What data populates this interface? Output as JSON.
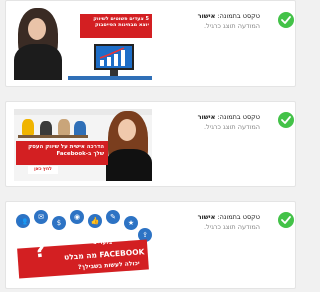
{
  "accent_check_color": "#43c248",
  "ad_red": "#d31f22",
  "ad_blue": "#2d73c4",
  "items": [
    {
      "status_label": "טקסט בתמונה:",
      "status_value": "אישור",
      "status_sub": "המודעה תוצג כרגיל.",
      "thumb": {
        "headline": "5 צעדים פשוטים לשיווק יוצא מבחינות הפייסבוק"
      }
    },
    {
      "status_label": "טקסט בתמונה:",
      "status_value": "אישור",
      "status_sub": "המודעה תוצג כרגיל.",
      "thumb": {
        "headline": "הדרכה אישית על שיווק העסק שלך ב-Facebook",
        "cta": "לחץ כאן"
      }
    },
    {
      "status_label": "טקסט בתמונה:",
      "status_value": "אישור",
      "status_sub": "המודעה תוצג כרגיל.",
      "thumb": {
        "kicker": "בלעדי ב",
        "headline": "FACEBOOK מה מבלט",
        "subline": "יכולה לעשות בשבילך?"
      }
    }
  ]
}
